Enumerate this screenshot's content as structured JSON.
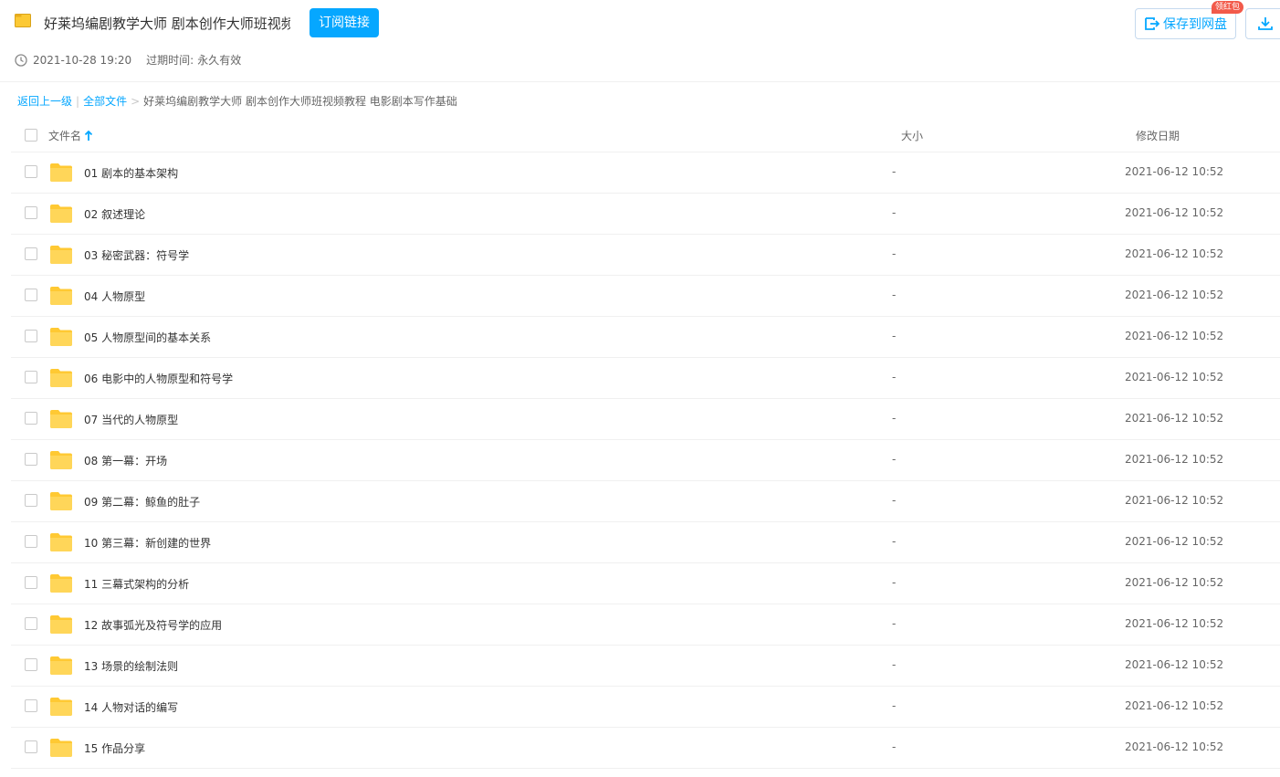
{
  "header": {
    "title": "好莱坞编剧教学大师 剧本创作大师班视频...",
    "subscribe_label": "订阅链接",
    "created": "2021-10-28 19:20",
    "expire_label": "过期时间:",
    "expire_value": "永久有效",
    "save_label": "保存到网盘",
    "badge_label": "领红包",
    "accent_color": "#06a7ff"
  },
  "breadcrumb": {
    "back": "返回上一级",
    "divider": "|",
    "all_files": "全部文件",
    "arrow": ">",
    "current": "好莱坞编剧教学大师 剧本创作大师班视频教程 电影剧本写作基础"
  },
  "table": {
    "col_name": "文件名",
    "col_size": "大小",
    "col_date": "修改日期",
    "rows": [
      {
        "name": "01 剧本的基本架构",
        "size": "-",
        "date": "2021-06-12 10:52"
      },
      {
        "name": "02 叙述理论",
        "size": "-",
        "date": "2021-06-12 10:52"
      },
      {
        "name": "03 秘密武器：符号学",
        "size": "-",
        "date": "2021-06-12 10:52"
      },
      {
        "name": "04 人物原型",
        "size": "-",
        "date": "2021-06-12 10:52"
      },
      {
        "name": "05 人物原型间的基本关系",
        "size": "-",
        "date": "2021-06-12 10:52"
      },
      {
        "name": "06 电影中的人物原型和符号学",
        "size": "-",
        "date": "2021-06-12 10:52"
      },
      {
        "name": "07 当代的人物原型",
        "size": "-",
        "date": "2021-06-12 10:52"
      },
      {
        "name": "08 第一幕：开场",
        "size": "-",
        "date": "2021-06-12 10:52"
      },
      {
        "name": "09 第二幕：鲸鱼的肚子",
        "size": "-",
        "date": "2021-06-12 10:52"
      },
      {
        "name": "10 第三幕：新创建的世界",
        "size": "-",
        "date": "2021-06-12 10:52"
      },
      {
        "name": "11 三幕式架构的分析",
        "size": "-",
        "date": "2021-06-12 10:52"
      },
      {
        "name": "12 故事弧光及符号学的应用",
        "size": "-",
        "date": "2021-06-12 10:52"
      },
      {
        "name": "13 场景的绘制法则",
        "size": "-",
        "date": "2021-06-12 10:52"
      },
      {
        "name": "14 人物对话的编写",
        "size": "-",
        "date": "2021-06-12 10:52"
      },
      {
        "name": "15 作品分享",
        "size": "-",
        "date": "2021-06-12 10:52"
      }
    ]
  }
}
